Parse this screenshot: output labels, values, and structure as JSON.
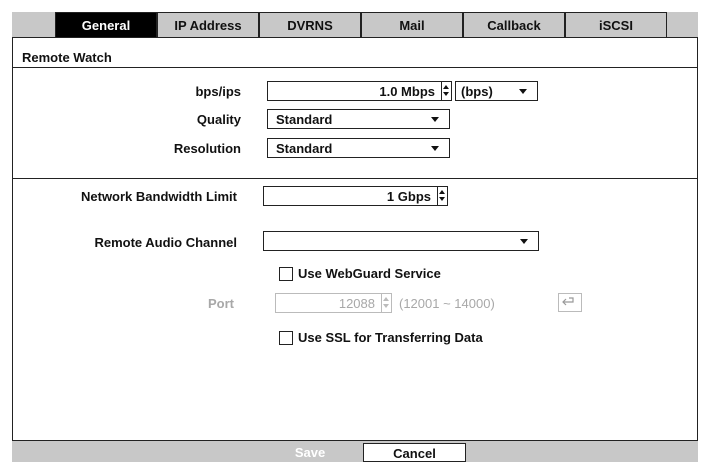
{
  "tabs": [
    {
      "label": "General",
      "active": true
    },
    {
      "label": "IP Address"
    },
    {
      "label": "DVRNS"
    },
    {
      "label": "Mail"
    },
    {
      "label": "Callback"
    },
    {
      "label": "iSCSI"
    }
  ],
  "remote_watch": {
    "title": "Remote Watch",
    "bps_label": "bps/ips",
    "bps_value": "1.0 Mbps",
    "bps_unit": "(bps)",
    "quality_label": "Quality",
    "quality_value": "Standard",
    "resolution_label": "Resolution",
    "resolution_value": "Standard"
  },
  "network": {
    "bandwidth_label": "Network Bandwidth Limit",
    "bandwidth_value": "1 Gbps",
    "audio_label": "Remote Audio Channel",
    "audio_value": ""
  },
  "webguard": {
    "label": "Use WebGuard Service",
    "checked": false,
    "port_label": "Port",
    "port_value": "12088",
    "port_range": "(12001 ~ 14000)"
  },
  "ssl": {
    "label": "Use SSL for Transferring Data",
    "checked": false
  },
  "footer": {
    "save_label": "Save",
    "cancel_label": "Cancel"
  },
  "icons": {
    "undo": "undo-arrow-icon",
    "dropdown": "chevron-down-icon",
    "spinner": "spin-up-down-icon"
  }
}
